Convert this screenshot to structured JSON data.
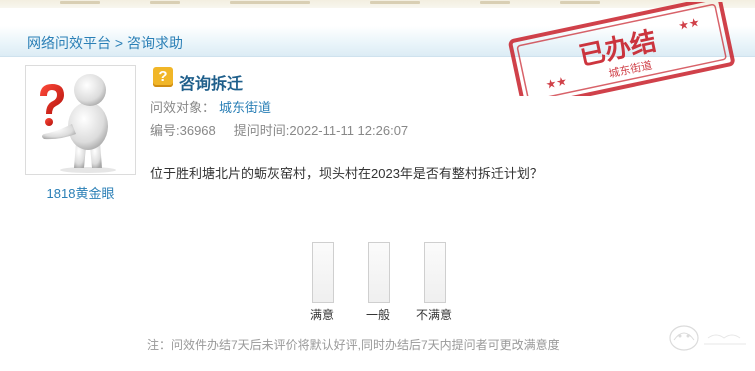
{
  "breadcrumb": {
    "home": "网络问效平台",
    "separator": ">",
    "current": "咨询求助"
  },
  "user": {
    "name": "1818黄金眼",
    "avatar_icon": "question-person-icon"
  },
  "question": {
    "icon": "question-mark-icon",
    "title": "咨询拆迁",
    "target_label": "问效对象：",
    "target": "城东街道",
    "number_label": "编号:36968",
    "time_label": "提问时间:2022-11-11 12:26:07",
    "content": "位于胜利塘北片的蛎灰窑村，坝头村在2023年是否有整村拆迁计划？"
  },
  "stamp": {
    "main_text": "已办结",
    "sub_text": "城东街道",
    "color": "#c8202a"
  },
  "rating": {
    "options": [
      {
        "label": "满意"
      },
      {
        "label": "一般"
      },
      {
        "label": "不满意"
      }
    ]
  },
  "note": "注：问效件办结7天后未评价将默认好评,同时办结后7天内提问者可更改满意度",
  "colors": {
    "link": "#2a7fb6",
    "title": "#1f5f8b",
    "muted": "#888888"
  }
}
